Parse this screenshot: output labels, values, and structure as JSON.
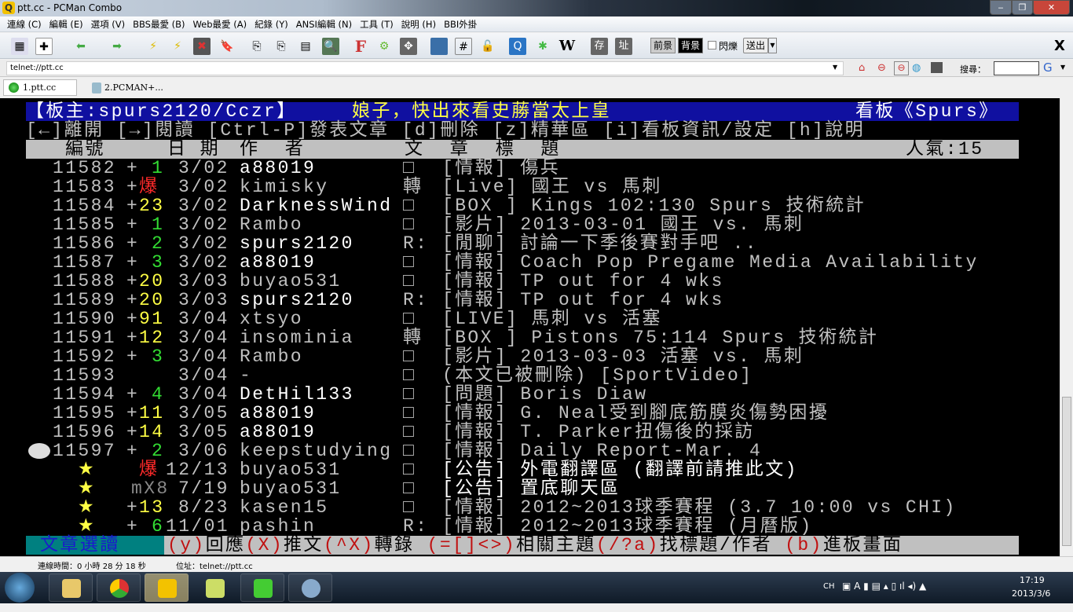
{
  "window": {
    "title": "ptt.cc - PCMan Combo"
  },
  "menu": [
    "連線 (C)",
    "編輯 (E)",
    "選項 (V)",
    "BBS最愛 (B)",
    "Web最愛 (A)",
    "紀錄 (Y)",
    "ANSI編輯 (N)",
    "工具 (T)",
    "說明 (H)",
    "BBI外掛"
  ],
  "toolbar": {
    "fg": "前景",
    "bg": "背景",
    "blink": "閃爍",
    "send": "送出",
    "save": "存",
    "addr": "址",
    "wiki": "W",
    "f": "F",
    "close": "X"
  },
  "address": {
    "value": "telnet://ptt.cc",
    "search_label": "搜尋："
  },
  "tabs": [
    "1.ptt.cc",
    "2.PCMAN+..."
  ],
  "terminal": {
    "header": {
      "moderator": "【板主:spurs2120/Cczr】",
      "slogan": "娘子，快出來看史蕂當太上皇",
      "board": "看板《Spurs》"
    },
    "help": "[←]離開 [→]閱讀 [Ctrl-P]發表文章 [d]刪除 [z]精華區 [i]看板資訊/設定 [h]說明",
    "columns": {
      "num": "編號",
      "date": "日 期",
      "author": "作  者",
      "title": "文  章  標  題",
      "popularity": "人氣:15"
    },
    "rows": [
      {
        "num": "11582",
        "rec": "1",
        "rc": "g",
        "date": "3/02",
        "author": "a88019",
        "ab": true,
        "mark": "□",
        "title": "[情報] 傷兵"
      },
      {
        "num": "11583",
        "rec": "爆",
        "rc": "r",
        "date": "3/02",
        "author": "kimisky",
        "ab": false,
        "mark": "轉",
        "title": "[Live] 國王 vs 馬刺"
      },
      {
        "num": "11584",
        "rec": "23",
        "rc": "y",
        "date": "3/02",
        "author": "DarknessWind",
        "ab": true,
        "mark": "□",
        "title": "[BOX ] Kings 102:130 Spurs 技術統計"
      },
      {
        "num": "11585",
        "rec": "1",
        "rc": "g",
        "date": "3/02",
        "author": "Rambo",
        "ab": false,
        "mark": "□",
        "title": "[影片] 2013-03-01 國王 vs. 馬刺"
      },
      {
        "num": "11586",
        "rec": "2",
        "rc": "g",
        "date": "3/02",
        "author": "spurs2120",
        "ab": true,
        "mark": "R:",
        "title": "[閒聊] 討論一下季後賽對手吧 .."
      },
      {
        "num": "11587",
        "rec": "3",
        "rc": "g",
        "date": "3/02",
        "author": "a88019",
        "ab": true,
        "mark": "□",
        "title": "[情報] Coach Pop Pregame Media Availability"
      },
      {
        "num": "11588",
        "rec": "20",
        "rc": "y",
        "date": "3/03",
        "author": "buyao531",
        "ab": false,
        "mark": "□",
        "title": "[情報] TP out for 4 wks"
      },
      {
        "num": "11589",
        "rec": "20",
        "rc": "y",
        "date": "3/03",
        "author": "spurs2120",
        "ab": true,
        "mark": "R:",
        "title": "[情報] TP out for 4 wks"
      },
      {
        "num": "11590",
        "rec": "91",
        "rc": "y",
        "date": "3/04",
        "author": "xtsyo",
        "ab": false,
        "mark": "□",
        "title": "[LIVE] 馬刺 vs 活塞"
      },
      {
        "num": "11591",
        "rec": "12",
        "rc": "y",
        "date": "3/04",
        "author": "insominia",
        "ab": false,
        "mark": "轉",
        "title": "[BOX ] Pistons 75:114 Spurs 技術統計"
      },
      {
        "num": "11592",
        "rec": "3",
        "rc": "g",
        "date": "3/04",
        "author": "Rambo",
        "ab": false,
        "mark": "□",
        "title": "[影片] 2013-03-03 活塞 vs. 馬刺"
      },
      {
        "num": "11593",
        "rec": "",
        "rc": "g",
        "date": "3/04",
        "author": "-",
        "ab": false,
        "mark": "□",
        "title": "(本文已被刪除) [SportVideo]"
      },
      {
        "num": "11594",
        "rec": "4",
        "rc": "g",
        "date": "3/04",
        "author": "DetHil133",
        "ab": true,
        "mark": "□",
        "title": "[問題] Boris Diaw"
      },
      {
        "num": "11595",
        "rec": "11",
        "rc": "y",
        "date": "3/05",
        "author": "a88019",
        "ab": true,
        "mark": "□",
        "title": "[情報] G. Neal受到腳底筋膜炎傷勢困擾"
      },
      {
        "num": "11596",
        "rec": "14",
        "rc": "y",
        "date": "3/05",
        "author": "a88019",
        "ab": true,
        "mark": "□",
        "title": "[情報] T. Parker扭傷後的採訪"
      },
      {
        "num": "11597",
        "rec": "2",
        "rc": "g",
        "date": "3/06",
        "author": "keepstudying",
        "ab": false,
        "mark": "□",
        "title": "[情報] Daily Report-Mar. 4"
      },
      {
        "num": "★",
        "rec": "爆",
        "rc": "r",
        "date": "12/13",
        "author": "buyao531",
        "ab": false,
        "mark": "□",
        "title": "[公告] 外電翻譯區 (翻譯前請推此文)",
        "tb": true
      },
      {
        "num": "★",
        "rec": "mX8",
        "rc": "dim",
        "date": "7/19",
        "author": "buyao531",
        "ab": false,
        "mark": "□",
        "title": "[公告] 置底聊天區",
        "tb": true
      },
      {
        "num": "★",
        "rec": "13",
        "rc": "y",
        "date": "8/23",
        "author": "kasen15",
        "ab": false,
        "mark": "□",
        "title": "[情報] 2012~2013球季賽程 (3.7 10:00 vs CHI)"
      },
      {
        "num": "★",
        "rec": "6",
        "rc": "g",
        "date": "11/01",
        "author": "pashin",
        "ab": false,
        "mark": "R:",
        "title": "[情報] 2012~2013球季賽程 (月曆版)"
      }
    ],
    "footer": {
      "mode": "文章選讀",
      "keys": [
        [
          "(y)",
          "回應"
        ],
        [
          "(X)",
          "推文"
        ],
        [
          "(^X)",
          "轉錄"
        ],
        [
          "(=[]<>)",
          "相關主題"
        ],
        [
          "(/?a)",
          "找標題/作者"
        ],
        [
          "(b)",
          "進板畫面"
        ]
      ]
    }
  },
  "status": {
    "connected": "連線時間：0 小時 28 分 18 秒",
    "address": "位址：telnet://ptt.cc"
  },
  "taskbar": {
    "lang": "CH",
    "time": "17:19",
    "date": "2013/3/6"
  }
}
